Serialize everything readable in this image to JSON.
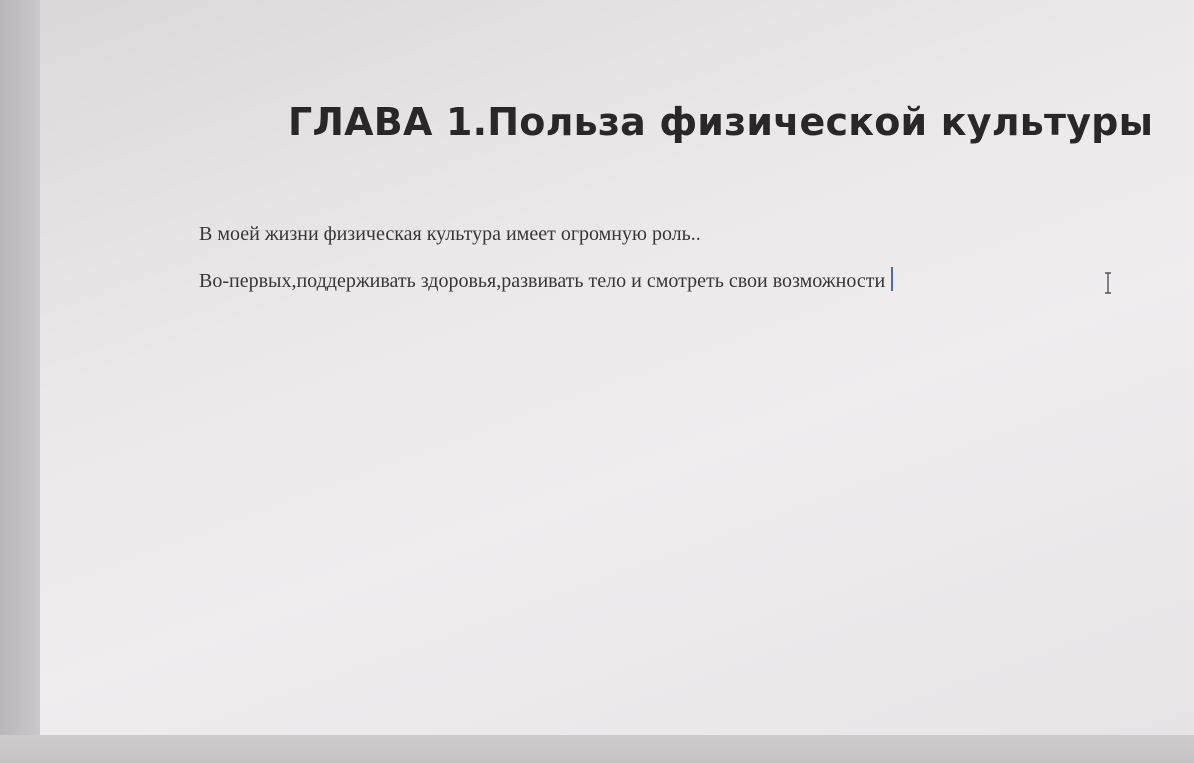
{
  "document": {
    "heading": "ГЛАВА 1.Польза физической культуры",
    "paragraphs": [
      "В моей жизни физическая культура имеет огромную роль..",
      "Во-первых,поддерживать здоровья,развивать тело и смотреть свои возможности"
    ]
  },
  "colors": {
    "text": "#3a3638",
    "heading": "#2a2729",
    "caret": "#3a6fcf"
  },
  "icons": {
    "cursor": "i-beam-cursor-icon"
  }
}
